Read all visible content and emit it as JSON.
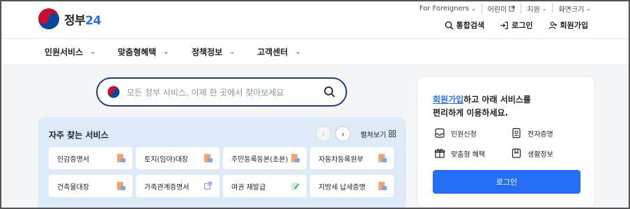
{
  "brand": {
    "text": "정부",
    "number": "24",
    "accent": "#256ef4"
  },
  "utility": [
    {
      "label": "For Foreigners",
      "icon": "chevron-down-icon"
    },
    {
      "label": "어린이",
      "icon": "external-link-icon"
    },
    {
      "label": "지원",
      "icon": "chevron-down-icon"
    },
    {
      "label": "화면크기",
      "icon": "chevron-down-icon"
    }
  ],
  "actions": {
    "search": "통합검색",
    "login": "로그인",
    "signup": "회원가입"
  },
  "gnb": [
    "민원서비스",
    "맞춤형혜택",
    "정책정보",
    "고객센터"
  ],
  "search": {
    "placeholder": "모든 정부 서비스, 이제 한 곳에서 찾아보세요"
  },
  "favorites": {
    "title": "자주 찾는 서비스",
    "spread_label": "펼쳐보기",
    "items": [
      "인감증명서",
      "토지(임야)대장",
      "주민등록등본(초본)",
      "자동차등록원부",
      "건축물대장",
      "가족관계증명서",
      "여권 재발급",
      "지방세 납세증명"
    ]
  },
  "panel": {
    "signup_link": "회원가입",
    "msg_rest": "하고 아래 서비스를",
    "msg_line2": "편리하게 이용하세요.",
    "items": [
      {
        "label": "민원신청",
        "icon": "inbox-icon"
      },
      {
        "label": "전자증명",
        "icon": "certificate-icon"
      },
      {
        "label": "맞춤형 혜택",
        "icon": "gift-icon"
      },
      {
        "label": "생활정보",
        "icon": "bookmark-icon"
      }
    ],
    "login_button": "로그인"
  },
  "colors": {
    "primary": "#256ef4",
    "search_border": "#1b3d8f",
    "favorites_bg": "#ddeaf7",
    "page_bg": "#f4f5f6"
  }
}
